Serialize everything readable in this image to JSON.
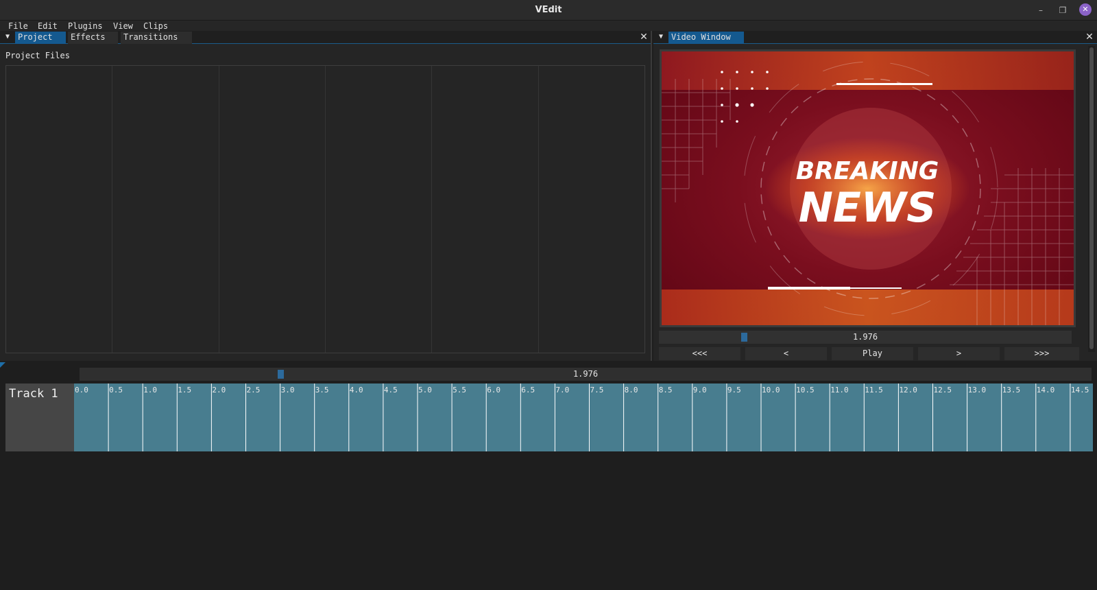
{
  "window": {
    "title": "VEdit",
    "minimize_glyph": "–",
    "maximize_glyph": "❐",
    "close_glyph": "✕"
  },
  "menu": [
    "File",
    "Edit",
    "Plugins",
    "View",
    "Clips"
  ],
  "left_panel": {
    "tabs": [
      "Project",
      "Effects",
      "Transitions"
    ],
    "active_tab": "Project",
    "section_label": "Project Files",
    "grid_columns": 6,
    "close_glyph": "✕",
    "collapse_glyph": "▼"
  },
  "right_panel": {
    "tabs": [
      "Video Window"
    ],
    "close_glyph": "✕",
    "collapse_glyph": "▼",
    "video_headline_top": "BREAKING",
    "video_headline_bottom": "NEWS",
    "video_colors": {
      "base": "#7a0e1e",
      "accent": "#e8581a",
      "text": "#ffffff"
    },
    "position_value": "1.976",
    "controls": [
      "<<<",
      "<",
      "Play",
      ">",
      ">>>"
    ]
  },
  "timeline": {
    "position_value": "1.976",
    "track_name": "Track 1",
    "track_color": "#487d8f",
    "ticks": [
      "0.0",
      "0.5",
      "1.0",
      "1.5",
      "2.0",
      "2.5",
      "3.0",
      "3.5",
      "4.0",
      "4.5",
      "5.0",
      "5.5",
      "6.0",
      "6.5",
      "7.0",
      "7.5",
      "8.0",
      "8.5",
      "9.0",
      "9.5",
      "10.0",
      "10.5",
      "11.0",
      "11.5",
      "12.0",
      "12.5",
      "13.0",
      "13.5",
      "14.0",
      "14.5"
    ]
  }
}
